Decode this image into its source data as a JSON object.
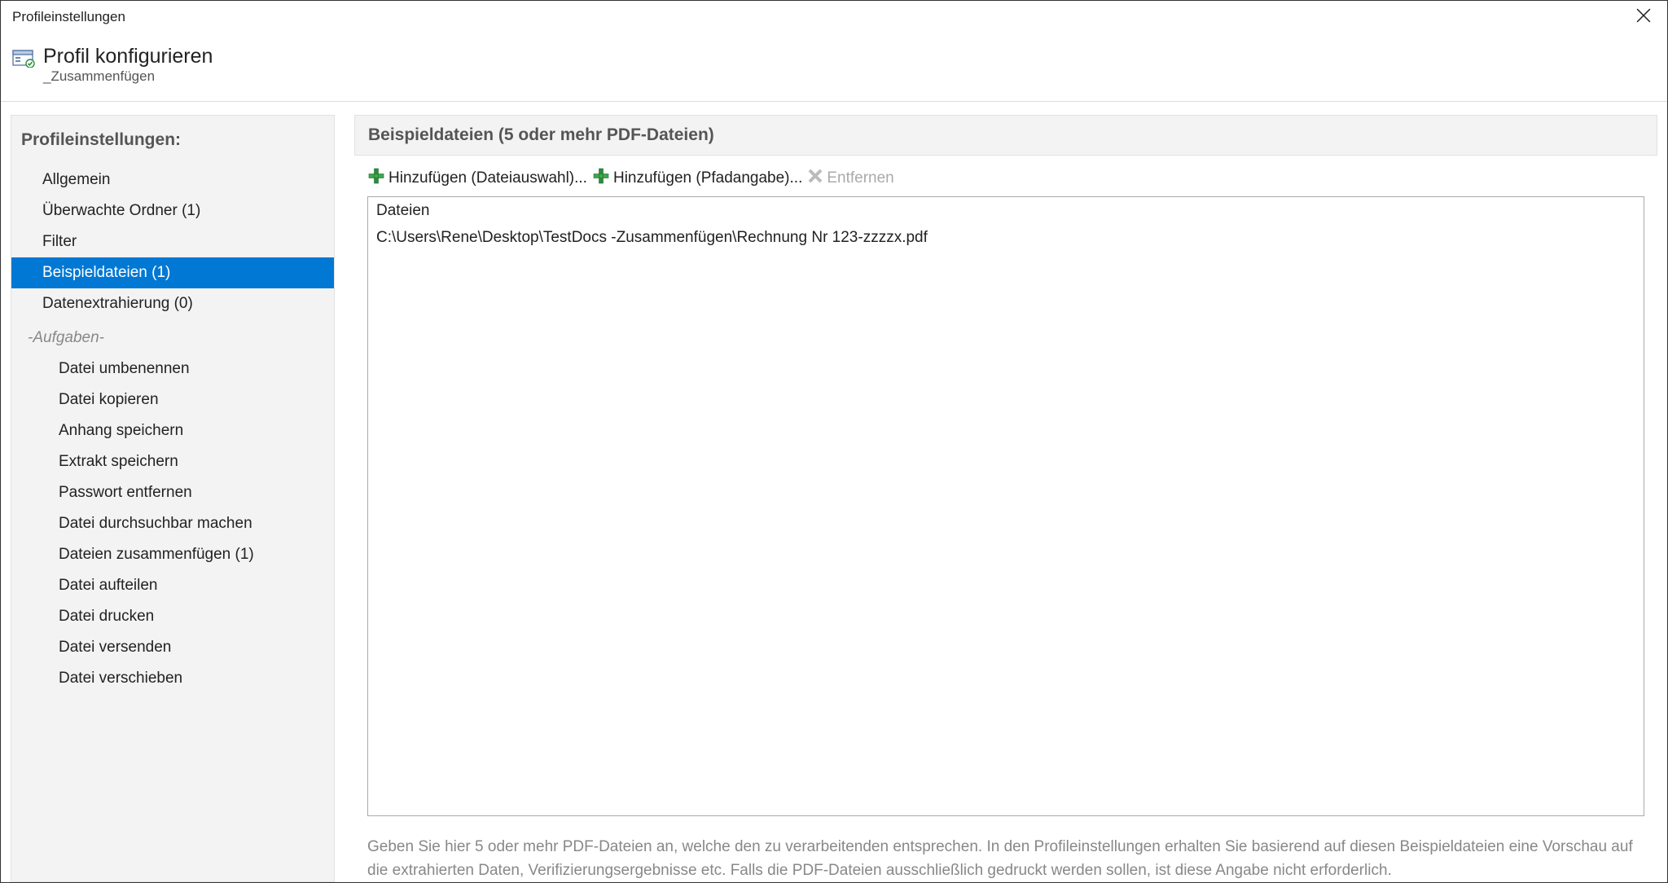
{
  "window": {
    "title": "Profileinstellungen"
  },
  "header": {
    "title": "Profil konfigurieren",
    "subtitle": "_Zusammenfügen"
  },
  "sidebar": {
    "section_title": "Profileinstellungen:",
    "items": [
      {
        "label": "Allgemein",
        "selected": false
      },
      {
        "label": "Überwachte Ordner (1)",
        "selected": false
      },
      {
        "label": "Filter",
        "selected": false
      },
      {
        "label": "Beispieldateien (1)",
        "selected": true
      },
      {
        "label": "Datenextrahierung (0)",
        "selected": false
      }
    ],
    "group_label": "-Aufgaben-",
    "subitems": [
      {
        "label": "Datei umbenennen"
      },
      {
        "label": "Datei kopieren"
      },
      {
        "label": "Anhang speichern"
      },
      {
        "label": "Extrakt speichern"
      },
      {
        "label": "Passwort entfernen"
      },
      {
        "label": "Datei durchsuchbar machen"
      },
      {
        "label": "Dateien zusammenfügen (1)"
      },
      {
        "label": "Datei aufteilen"
      },
      {
        "label": "Datei drucken"
      },
      {
        "label": "Datei versenden"
      },
      {
        "label": "Datei verschieben"
      }
    ]
  },
  "panel": {
    "title": "Beispieldateien (5 oder mehr PDF-Dateien)"
  },
  "toolbar": {
    "add_file_label": "Hinzufügen (Dateiauswahl)...",
    "add_path_label": "Hinzufügen (Pfadangabe)...",
    "remove_label": "Entfernen"
  },
  "filelist": {
    "header": "Dateien",
    "rows": [
      "C:\\Users\\Rene\\Desktop\\TestDocs -Zusammenfügen\\Rechnung Nr 123-zzzzx.pdf"
    ]
  },
  "help": {
    "text": "Geben Sie hier 5 oder mehr PDF-Dateien an, welche den zu verarbeitenden entsprechen. In den Profileinstellungen erhalten Sie basierend auf diesen Beispieldateien eine Vorschau auf die extrahierten Daten, Verifizierungsergebnisse etc. Falls die PDF-Dateien ausschließlich gedruckt werden sollen, ist diese Angabe nicht erforderlich."
  }
}
